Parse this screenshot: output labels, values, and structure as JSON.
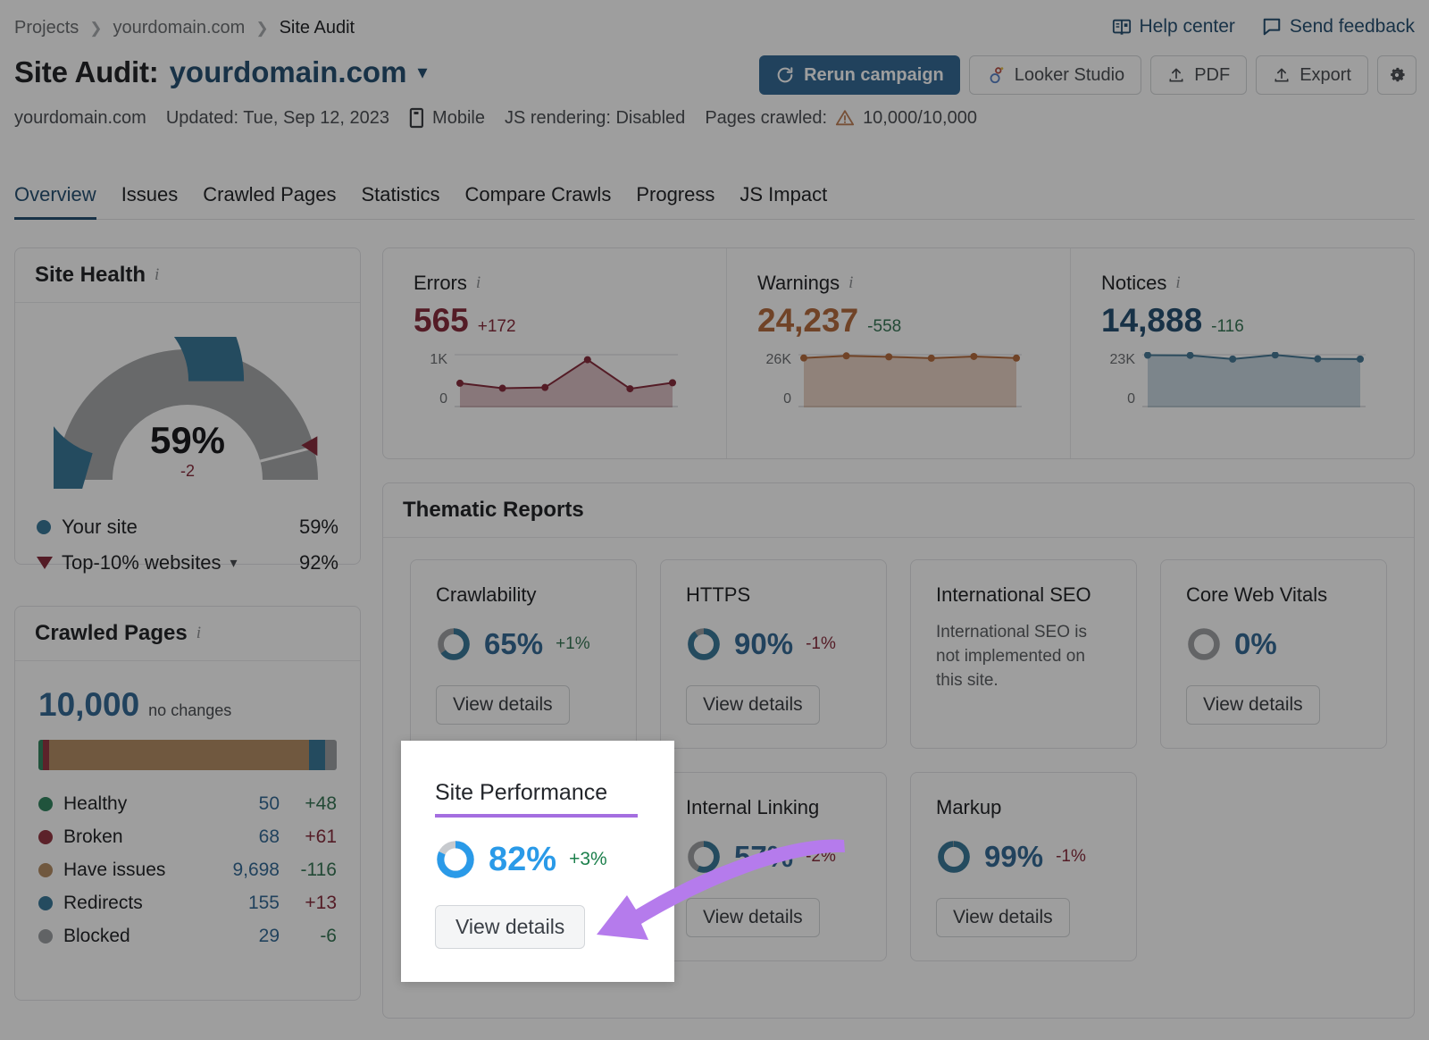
{
  "breadcrumb": [
    "Projects",
    "yourdomain.com",
    "Site Audit"
  ],
  "toplinks": [
    {
      "icon": "book-icon",
      "label": "Help center"
    },
    {
      "icon": "feedback-icon",
      "label": "Send feedback"
    }
  ],
  "header": {
    "title_static": "Site Audit:",
    "title_domain": "yourdomain.com",
    "caret": "⌄"
  },
  "actions": {
    "rerun": "Rerun campaign",
    "looker": "Looker Studio",
    "pdf": "PDF",
    "export": "Export",
    "settings_icon": "gear-icon"
  },
  "meta": {
    "domain": "yourdomain.com",
    "updated": "Updated: Tue, Sep 12, 2023",
    "device": "Mobile",
    "js": "JS rendering: Disabled",
    "pages_label": "Pages crawled:",
    "pages_value": "10,000/10,000"
  },
  "tabs": [
    {
      "label": "Overview",
      "active": true
    },
    {
      "label": "Issues",
      "active": false
    },
    {
      "label": "Crawled Pages",
      "active": false
    },
    {
      "label": "Statistics",
      "active": false
    },
    {
      "label": "Compare Crawls",
      "active": false
    },
    {
      "label": "Progress",
      "active": false
    },
    {
      "label": "JS Impact",
      "active": false
    }
  ],
  "site_health": {
    "title": "Site Health",
    "value": "59%",
    "delta": "-2",
    "legend": [
      {
        "label": "Your site",
        "value": "59%",
        "marker": "dot",
        "color": "#1a7fb5"
      },
      {
        "label": "Top-10% websites",
        "value": "92%",
        "marker": "triangle",
        "color": "#b3203b",
        "has_caret": true
      }
    ]
  },
  "stats": [
    {
      "name": "Errors",
      "value": "565",
      "delta": "+172",
      "value_color": "#b3203b",
      "delta_color": "#b3203b",
      "axis_top": "1K",
      "axis_bottom": "0",
      "line_color": "#b3203b",
      "fill_color": "#b3203b"
    },
    {
      "name": "Warnings",
      "value": "24,237",
      "delta": "-558",
      "value_color": "#d9651b",
      "delta_color": "#1b7f4b",
      "axis_top": "26K",
      "axis_bottom": "0",
      "line_color": "#d9651b",
      "fill_color": "#d9651b"
    },
    {
      "name": "Notices",
      "value": "14,888",
      "delta": "-116",
      "value_color": "#12558a",
      "delta_color": "#1b7f4b",
      "axis_top": "23K",
      "axis_bottom": "0",
      "line_color": "#2d7fae",
      "fill_color": "#2d7fae"
    }
  ],
  "crawled_pages": {
    "title": "Crawled Pages",
    "total": "10,000",
    "change": "no changes",
    "rows": [
      {
        "label": "Healthy",
        "count": "50",
        "delta": "+48",
        "color": "#0e9257",
        "delta_dir": "up",
        "bar_pct": 1.6
      },
      {
        "label": "Broken",
        "count": "68",
        "delta": "+61",
        "color": "#c02b3e",
        "delta_dir": "down",
        "bar_pct": 2.0
      },
      {
        "label": "Have issues",
        "count": "9,698",
        "delta": "-116",
        "color": "#c98a4b",
        "delta_dir": "up",
        "bar_pct": 87.2
      },
      {
        "label": "Redirects",
        "count": "155",
        "delta": "+13",
        "color": "#1a7fb5",
        "delta_dir": "down",
        "bar_pct": 5.2
      },
      {
        "label": "Blocked",
        "count": "29",
        "delta": "-6",
        "color": "#9aa0a6",
        "delta_dir": "up",
        "bar_pct": 4.0
      }
    ]
  },
  "thematic": {
    "title": "Thematic Reports",
    "button_label": "View details",
    "cards": [
      {
        "name": "Crawlability",
        "pct": "65%",
        "pct_num": 65,
        "delta": "+1%",
        "delta_dir": "up",
        "has_button": true,
        "note": ""
      },
      {
        "name": "HTTPS",
        "pct": "90%",
        "pct_num": 90,
        "delta": "-1%",
        "delta_dir": "down",
        "has_button": true,
        "note": ""
      },
      {
        "name": "International SEO",
        "pct": "",
        "pct_num": 0,
        "delta": "",
        "delta_dir": "",
        "has_button": false,
        "note": "International SEO is not implemented on this site."
      },
      {
        "name": "Core Web Vitals",
        "pct": "0%",
        "pct_num": 0,
        "delta": "",
        "delta_dir": "",
        "has_button": true,
        "note": ""
      },
      {
        "name": "Site Performance",
        "pct": "82%",
        "pct_num": 82,
        "delta": "+3%",
        "delta_dir": "up",
        "has_button": true,
        "note": ""
      },
      {
        "name": "Internal Linking",
        "pct": "57%",
        "pct_num": 57,
        "delta": "-2%",
        "delta_dir": "down",
        "has_button": true,
        "note": ""
      },
      {
        "name": "Markup",
        "pct": "99%",
        "pct_num": 99,
        "delta": "-1%",
        "delta_dir": "down",
        "has_button": true,
        "note": ""
      }
    ]
  },
  "callout": {
    "title": "Site Performance",
    "pct": "82%",
    "delta": "+3%",
    "button_label": "View details",
    "underline_color": "#a46ee0",
    "arrow_color": "#b57bec"
  },
  "chart_data": [
    {
      "type": "line",
      "title": "Errors",
      "x": [
        1,
        2,
        3,
        4,
        5,
        6
      ],
      "values": [
        430,
        330,
        345,
        900,
        320,
        440
      ],
      "ylim": [
        0,
        1000
      ],
      "ylabel": "",
      "ticks": [
        "1K",
        "0"
      ]
    },
    {
      "type": "line",
      "title": "Warnings",
      "x": [
        1,
        2,
        3,
        4,
        5,
        6
      ],
      "values": [
        24300,
        25400,
        24900,
        24200,
        25100,
        24237
      ],
      "ylim": [
        0,
        26000
      ],
      "ylabel": "",
      "ticks": [
        "26K",
        "0"
      ]
    },
    {
      "type": "line",
      "title": "Notices",
      "x": [
        1,
        2,
        3,
        4,
        5,
        6
      ],
      "values": [
        22800,
        22700,
        21000,
        22900,
        21100,
        21000
      ],
      "ylim": [
        0,
        23000
      ],
      "ylabel": "",
      "ticks": [
        "23K",
        "0"
      ]
    }
  ]
}
